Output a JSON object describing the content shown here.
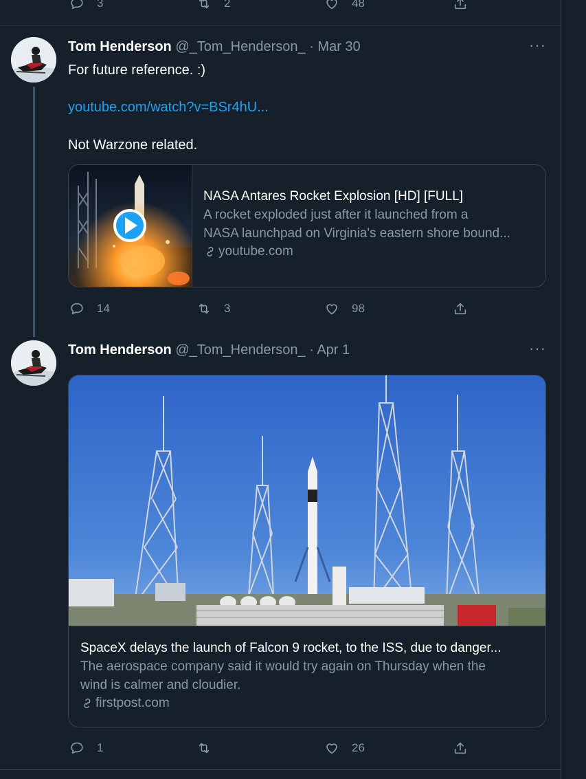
{
  "prev_tweet": {
    "reply_count": "3",
    "retweet_count": "2",
    "like_count": "48"
  },
  "tweets": [
    {
      "name": "Tom Henderson",
      "handle": "@_Tom_Henderson_",
      "separator": "·",
      "date": "Mar 30",
      "more": "···",
      "text_line1": "For future reference. :)",
      "link_text": "youtube.com/watch?v=BSr4hU...",
      "text_line3": "Not Warzone related.",
      "card": {
        "title": "NASA Antares Rocket Explosion [HD] [FULL]",
        "description_line1": "A rocket exploded just after it launched from a",
        "description_line2": "NASA launchpad on Virginia's eastern shore bound...",
        "domain": "youtube.com"
      },
      "reply_count": "14",
      "retweet_count": "3",
      "like_count": "98"
    },
    {
      "name": "Tom Henderson",
      "handle": "@_Tom_Henderson_",
      "separator": "·",
      "date": "Apr 1",
      "more": "···",
      "card": {
        "title": "SpaceX delays the launch of Falcon 9 rocket, to the ISS, due to danger...",
        "description_line1": "The aerospace company said it would try again on Thursday when the",
        "description_line2": "wind is calmer and cloudier.",
        "domain": "firstpost.com"
      },
      "reply_count": "1",
      "retweet_count": "",
      "like_count": "26"
    }
  ],
  "icons": {
    "reply": "reply-icon",
    "retweet": "retweet-icon",
    "like": "like-icon",
    "share": "share-icon",
    "link": "link-icon",
    "play": "play-icon"
  },
  "colors": {
    "background": "#15202b",
    "border": "#38444d",
    "secondary_text": "#8899a6",
    "link": "#1da1f2"
  }
}
